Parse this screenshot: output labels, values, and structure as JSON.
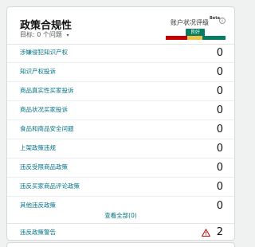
{
  "widget": {
    "title": "政策合规性",
    "target_label": "目标:",
    "target_value": "0 个问题",
    "account_health_label": "账户状况评级",
    "beta": "Beta",
    "info_icon": "info-icon",
    "status_badge": "良好",
    "gauge_colors": [
      "#c40000",
      "#f0c14b",
      "#067d62"
    ]
  },
  "rows": [
    {
      "label": "涉嫌侵犯知识产权",
      "count": "0"
    },
    {
      "label": "知识产权投诉",
      "count": "0"
    },
    {
      "label": "商品真实性买家投诉",
      "count": "0"
    },
    {
      "label": "商品状况买家投诉",
      "count": "0"
    },
    {
      "label": "食品和商品安全问题",
      "count": "0"
    },
    {
      "label": "上架政策违规",
      "count": "0"
    },
    {
      "label": "违反受限商品政策",
      "count": "0"
    },
    {
      "label": "违反买家商品评论政策",
      "count": "0"
    },
    {
      "label": "其他违反政策",
      "count": "0"
    }
  ],
  "view_all": "查看全部(0)",
  "warnings": {
    "label": "违反政策警告",
    "count": "2",
    "icon": "warning-icon"
  }
}
